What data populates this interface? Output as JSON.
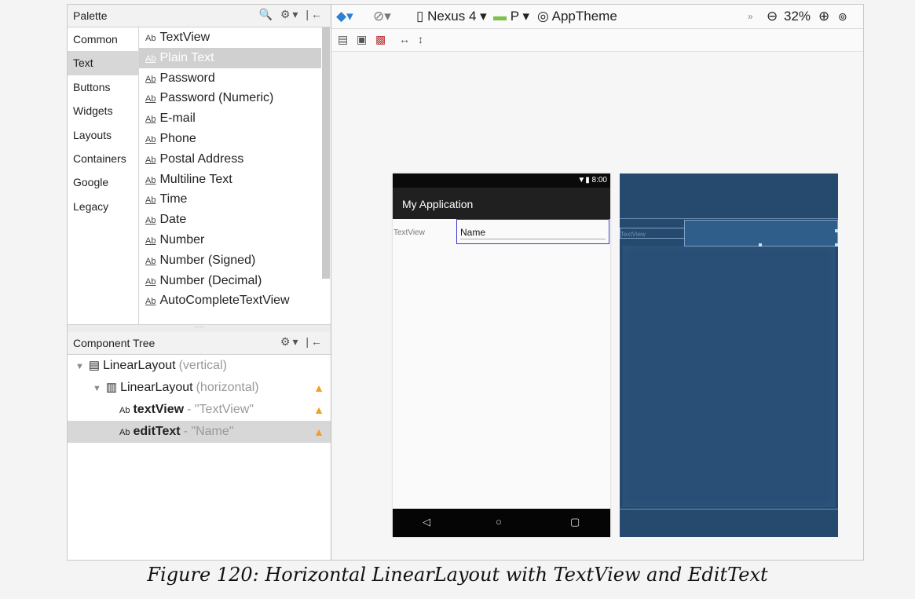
{
  "palette": {
    "title": "Palette",
    "tools": "🔍 ⚙▾ |←",
    "categories": [
      "Common",
      "Text",
      "Buttons",
      "Widgets",
      "Layouts",
      "Containers",
      "Google",
      "Legacy"
    ],
    "selected_category": "Text",
    "items": [
      {
        "ab": "Ab",
        "label": "TextView",
        "plain": true
      },
      {
        "ab": "Ab",
        "label": "Plain Text",
        "selected": true
      },
      {
        "ab": "Ab",
        "label": "Password"
      },
      {
        "ab": "Ab",
        "label": "Password (Numeric)"
      },
      {
        "ab": "Ab",
        "label": "E-mail"
      },
      {
        "ab": "Ab",
        "label": "Phone"
      },
      {
        "ab": "Ab",
        "label": "Postal Address"
      },
      {
        "ab": "Ab",
        "label": "Multiline Text"
      },
      {
        "ab": "Ab",
        "label": "Time"
      },
      {
        "ab": "Ab",
        "label": "Date"
      },
      {
        "ab": "Ab",
        "label": "Number"
      },
      {
        "ab": "Ab",
        "label": "Number (Signed)"
      },
      {
        "ab": "Ab",
        "label": "Number (Decimal)"
      },
      {
        "ab": "Ab",
        "label": "AutoCompleteTextView"
      }
    ]
  },
  "component_tree": {
    "title": "Component Tree",
    "tools": "⚙▾ |←",
    "rows": [
      {
        "name": "LinearLayout",
        "detail": "(vertical)",
        "indent": 0,
        "icon": "▤",
        "warn": false
      },
      {
        "name": "LinearLayout",
        "detail": "(horizontal)",
        "indent": 1,
        "icon": "▥",
        "warn": true
      },
      {
        "name": "textView",
        "detail": "- \"TextView\"",
        "indent": 2,
        "icon": "Ab",
        "warn": true,
        "bold": true
      },
      {
        "name": "editText",
        "detail": "- \"Name\"",
        "indent": 2,
        "icon": "Ab",
        "warn": true,
        "bold": true,
        "selected": true
      }
    ]
  },
  "toolbar": {
    "device": "Nexus 4",
    "api": "P",
    "theme": "AppTheme",
    "zoom": "32%"
  },
  "phone": {
    "time": "8:00",
    "app_title": "My Application",
    "textview_label": "TextView",
    "edittext_value": "Name"
  },
  "blueprint": {
    "textview_label": "TextView"
  },
  "caption": "Figure 120: Horizontal LinearLayout with TextView and EditText",
  "colors": {
    "accent_selection": "#3a3ad0",
    "blueprint_bg": "#26496e",
    "warning": "#f0a020"
  }
}
